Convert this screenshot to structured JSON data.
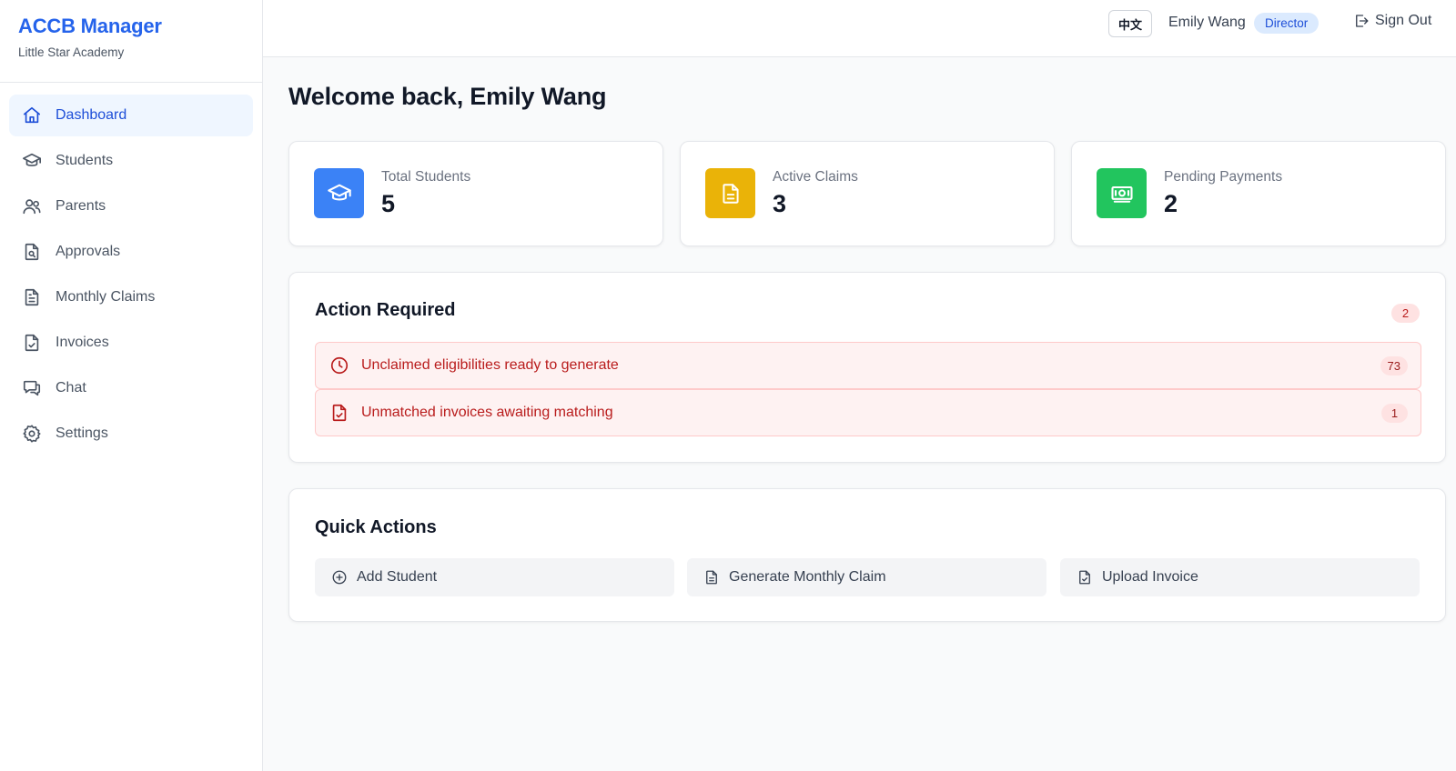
{
  "app": {
    "title": "ACCB Manager",
    "subtitle": "Little Star Academy"
  },
  "sidebar": {
    "items": [
      {
        "label": "Dashboard",
        "icon": "home-icon",
        "active": true
      },
      {
        "label": "Students",
        "icon": "graduation-cap-icon"
      },
      {
        "label": "Parents",
        "icon": "users-icon"
      },
      {
        "label": "Approvals",
        "icon": "file-search-icon"
      },
      {
        "label": "Monthly Claims",
        "icon": "file-text-icon"
      },
      {
        "label": "Invoices",
        "icon": "file-check-icon"
      },
      {
        "label": "Chat",
        "icon": "chat-icon"
      },
      {
        "label": "Settings",
        "icon": "gear-icon"
      }
    ]
  },
  "header": {
    "language_toggle": "中文",
    "user_name": "Emily Wang",
    "role": "Director",
    "sign_out": "Sign Out"
  },
  "main": {
    "welcome": "Welcome back, Emily Wang",
    "stats": [
      {
        "label": "Total Students",
        "value": "5",
        "color": "#3b82f6",
        "icon": "graduation-cap-icon"
      },
      {
        "label": "Active Claims",
        "value": "3",
        "color": "#eab308",
        "icon": "file-text-icon"
      },
      {
        "label": "Pending Payments",
        "value": "2",
        "color": "#22c55e",
        "icon": "banknote-icon"
      }
    ],
    "action_required": {
      "title": "Action Required",
      "count": "2",
      "items": [
        {
          "label": "Unclaimed eligibilities ready to generate",
          "count": "73",
          "icon": "clock-icon"
        },
        {
          "label": "Unmatched invoices awaiting matching",
          "count": "1",
          "icon": "file-check-icon"
        }
      ]
    },
    "quick_actions": {
      "title": "Quick Actions",
      "buttons": [
        {
          "label": "Add Student",
          "icon": "plus-circle-icon"
        },
        {
          "label": "Generate Monthly Claim",
          "icon": "file-text-icon"
        },
        {
          "label": "Upload Invoice",
          "icon": "file-check-icon"
        }
      ]
    }
  },
  "colors": {
    "brand": "#2563eb",
    "alert_text": "#b91c1c",
    "alert_bg": "#fef2f2"
  }
}
